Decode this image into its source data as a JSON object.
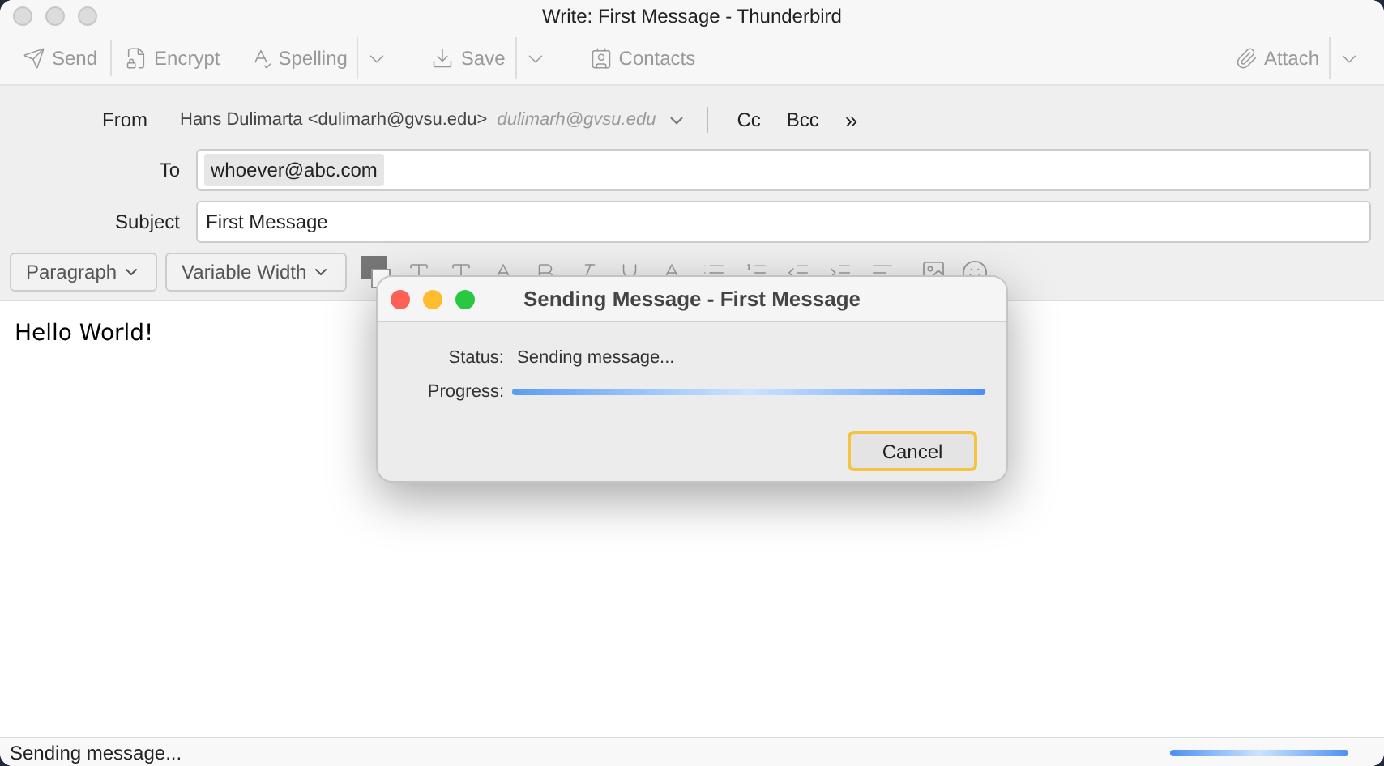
{
  "window": {
    "title": "Write: First Message - Thunderbird"
  },
  "toolbar": {
    "buttons": [
      {
        "label": "Send",
        "kind": "send"
      },
      {
        "label": "Encrypt",
        "kind": "encrypt"
      },
      {
        "label": "Spelling",
        "kind": "spelling"
      },
      {
        "label": "Save",
        "kind": "save"
      },
      {
        "label": "Contacts",
        "kind": "contacts"
      }
    ],
    "attach": "Attach"
  },
  "header": {
    "from_label": "From",
    "from_value": "Hans Dulimarta <dulimarh@gvsu.edu>",
    "from_identity": "dulimarh@gvsu.edu",
    "cc": "Cc",
    "bcc": "Bcc",
    "more": "»",
    "to_label": "To",
    "recipients": [
      "whoever@abc.com"
    ],
    "subject_label": "Subject",
    "subject": "First Message"
  },
  "format_bar": {
    "paragraph": "Paragraph",
    "font": "Variable Width"
  },
  "body": "Hello World!",
  "dialog": {
    "title": "Sending Message - First Message",
    "status_label": "Status:",
    "status": "Sending message...",
    "progress_label": "Progress:",
    "level": 1,
    "cancel": "Cancel"
  },
  "status_bar": {
    "text": "Sending message...",
    "level": 1
  }
}
